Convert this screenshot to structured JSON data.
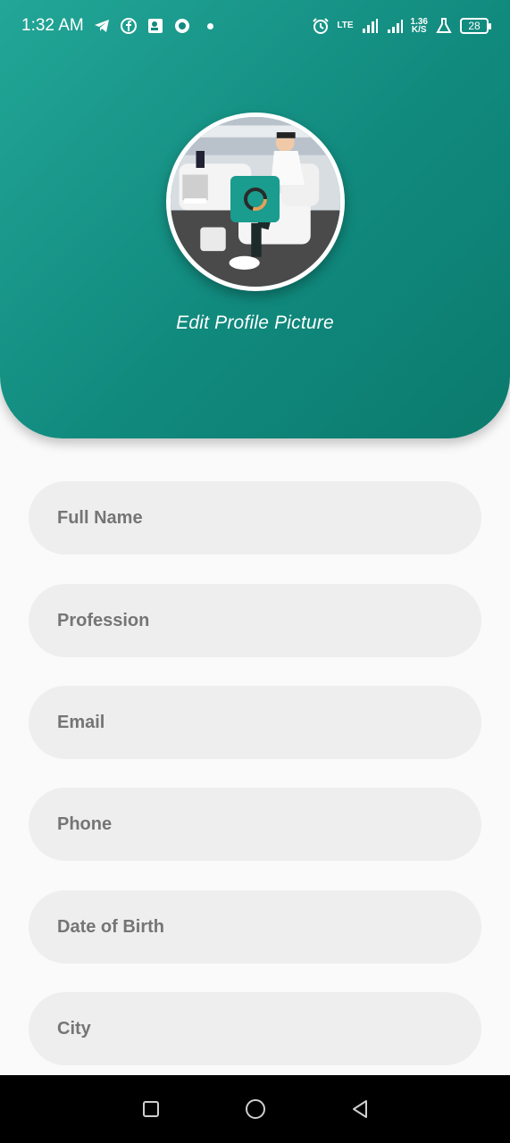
{
  "status_bar": {
    "time": "1:32 AM",
    "network_rate_top": "1.36",
    "network_rate_bottom": "K/S",
    "lte_label": "LTE",
    "battery_level": "28",
    "left_icons": [
      "telegram-icon",
      "facebook-icon",
      "contact-card-icon",
      "vpn-icon",
      "notification-dot-icon"
    ],
    "right_icons": [
      "alarm-icon",
      "lte-signal-icon",
      "signal-icon",
      "lab-icon",
      "battery-icon"
    ]
  },
  "header": {
    "edit_label": "Edit Profile Picture",
    "gradient_start": "#22a697",
    "gradient_end": "#0b7a6d",
    "camera_icon": "camera-icon"
  },
  "form": {
    "fields": [
      {
        "placeholder": "Full Name"
      },
      {
        "placeholder": "Profession"
      },
      {
        "placeholder": "Email"
      },
      {
        "placeholder": "Phone"
      },
      {
        "placeholder": "Date of Birth"
      },
      {
        "placeholder": "City"
      }
    ]
  },
  "nav": {
    "buttons": [
      "recents-icon",
      "home-icon",
      "back-icon"
    ]
  }
}
